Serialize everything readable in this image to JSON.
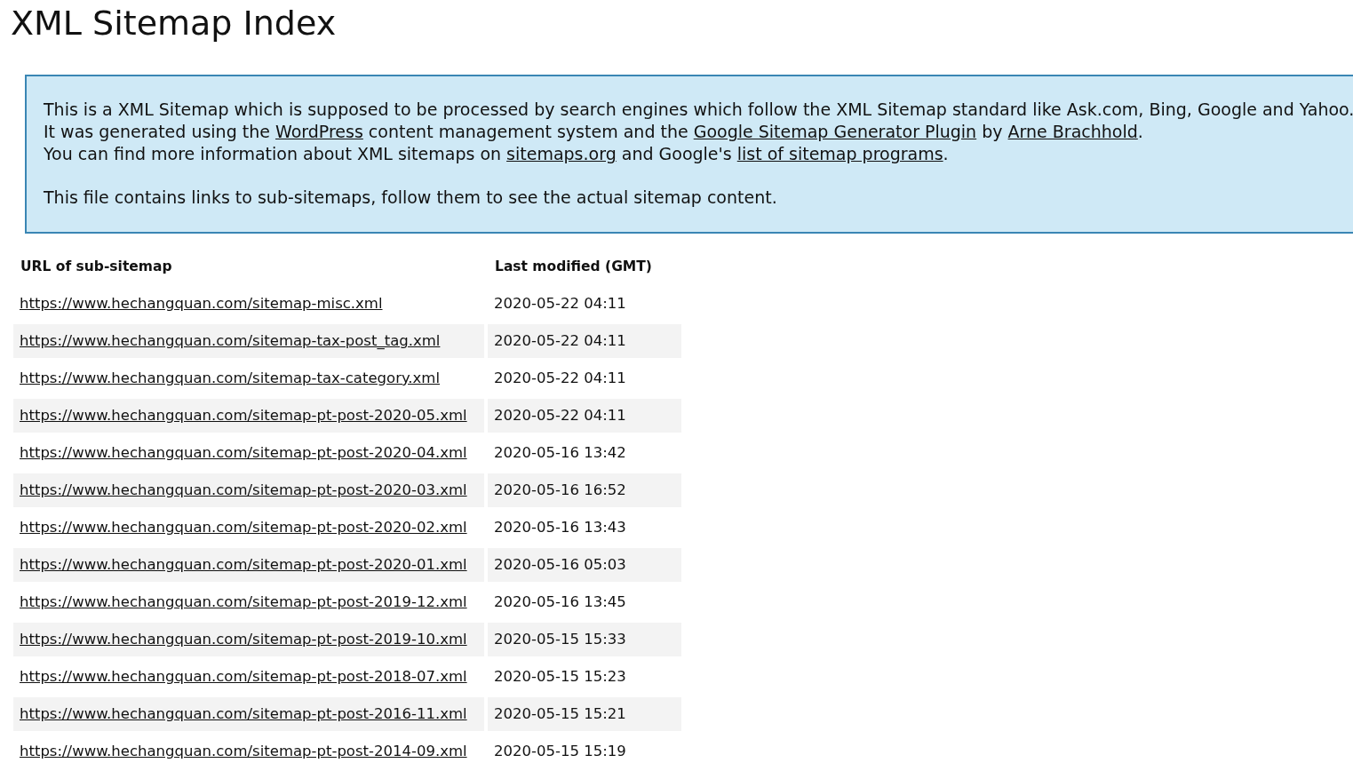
{
  "title": "XML Sitemap Index",
  "intro": {
    "lines": [
      "This is a XML Sitemap which is supposed to be processed by search engines which follow the XML Sitemap standard like Ask.com, Bing, Google and Yahoo.",
      [
        {
          "text": "It was generated using the "
        },
        {
          "text": "WordPress",
          "link": true
        },
        {
          "text": " content management system and the "
        },
        {
          "text": "Google Sitemap Generator Plugin",
          "link": true
        },
        {
          "text": " by "
        },
        {
          "text": "Arne Brachhold",
          "link": true
        },
        {
          "text": "."
        }
      ],
      [
        {
          "text": "You can find more information about XML sitemaps on "
        },
        {
          "text": "sitemaps.org",
          "link": true
        },
        {
          "text": " and Google's "
        },
        {
          "text": "list of sitemap programs",
          "link": true
        },
        {
          "text": "."
        }
      ]
    ],
    "note": "This file contains links to sub-sitemaps, follow them to see the actual sitemap content."
  },
  "table": {
    "columns": [
      "URL of sub-sitemap",
      "Last modified (GMT)"
    ],
    "rows": [
      {
        "url": "https://www.hechangquan.com/sitemap-misc.xml",
        "modified": "2020-05-22 04:11"
      },
      {
        "url": "https://www.hechangquan.com/sitemap-tax-post_tag.xml",
        "modified": "2020-05-22 04:11"
      },
      {
        "url": "https://www.hechangquan.com/sitemap-tax-category.xml",
        "modified": "2020-05-22 04:11"
      },
      {
        "url": "https://www.hechangquan.com/sitemap-pt-post-2020-05.xml",
        "modified": "2020-05-22 04:11"
      },
      {
        "url": "https://www.hechangquan.com/sitemap-pt-post-2020-04.xml",
        "modified": "2020-05-16 13:42"
      },
      {
        "url": "https://www.hechangquan.com/sitemap-pt-post-2020-03.xml",
        "modified": "2020-05-16 16:52"
      },
      {
        "url": "https://www.hechangquan.com/sitemap-pt-post-2020-02.xml",
        "modified": "2020-05-16 13:43"
      },
      {
        "url": "https://www.hechangquan.com/sitemap-pt-post-2020-01.xml",
        "modified": "2020-05-16 05:03"
      },
      {
        "url": "https://www.hechangquan.com/sitemap-pt-post-2019-12.xml",
        "modified": "2020-05-16 13:45"
      },
      {
        "url": "https://www.hechangquan.com/sitemap-pt-post-2019-10.xml",
        "modified": "2020-05-15 15:33"
      },
      {
        "url": "https://www.hechangquan.com/sitemap-pt-post-2018-07.xml",
        "modified": "2020-05-15 15:23"
      },
      {
        "url": "https://www.hechangquan.com/sitemap-pt-post-2016-11.xml",
        "modified": "2020-05-15 15:21"
      },
      {
        "url": "https://www.hechangquan.com/sitemap-pt-post-2014-09.xml",
        "modified": "2020-05-15 15:19"
      }
    ]
  }
}
